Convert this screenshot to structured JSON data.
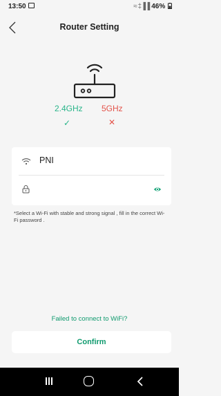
{
  "status_bar": {
    "time": "13:50",
    "signal": "≈ ‡▐▐",
    "battery": "46%"
  },
  "header": {
    "title": "Router Setting"
  },
  "bands": {
    "band_24": "2.4GHz",
    "band_5": "5GHz",
    "band_24_status": "✓",
    "band_5_status": "✕",
    "colors": {
      "supported": "#2ab58a",
      "unsupported": "#e3534a"
    }
  },
  "wifi_form": {
    "ssid": "PNI",
    "password_value": ""
  },
  "hint": "*Select a Wi-Fi with stable and strong signal , fill in the correct Wi-Fi password .",
  "failed_link": "Failed to connect to WiFi?",
  "confirm_label": "Confirm",
  "accent_color": "#0f9a6e",
  "icons": [
    "back-arrow-icon",
    "router-icon",
    "wifi-icon",
    "lock-icon",
    "eye-icon",
    "recents-icon",
    "home-icon",
    "back-icon"
  ]
}
